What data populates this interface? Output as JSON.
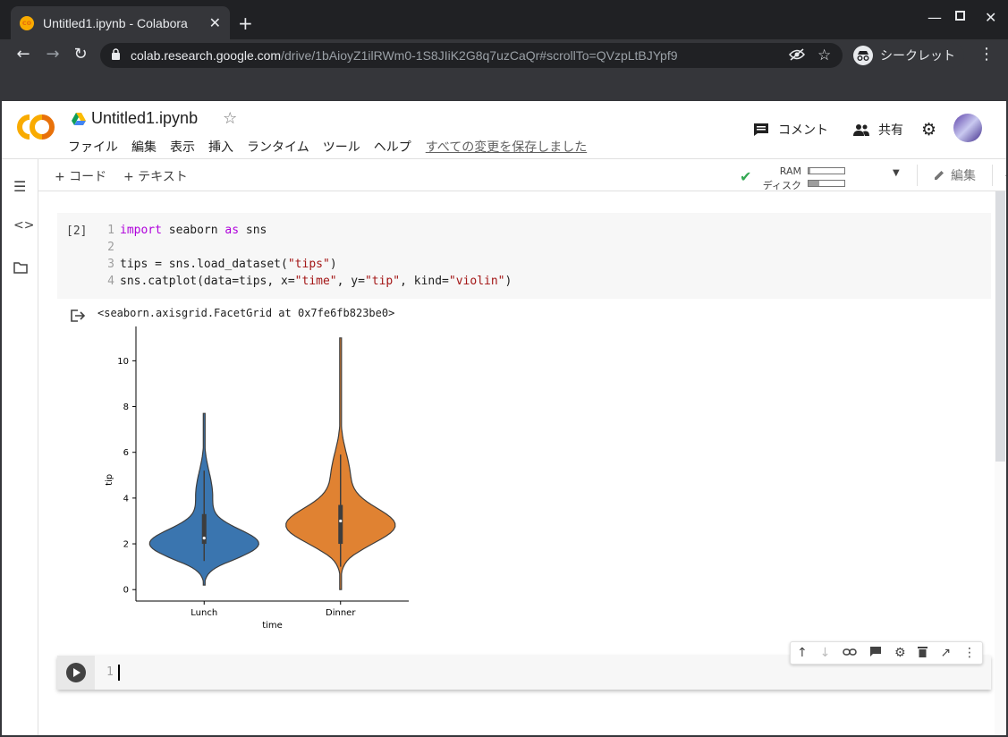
{
  "browser": {
    "tab_title": "Untitled1.ipynb - Colabora",
    "url_host": "colab.research.google.com",
    "url_path": "/drive/1bAioyZ1ilRWm0-1S8JIiK2G8q7uzCaQr#scrollTo=QVzpLtBJYpf9",
    "incognito_label": "シークレット"
  },
  "colab": {
    "doc_title": "Untitled1.ipynb",
    "menu": [
      "ファイル",
      "編集",
      "表示",
      "挿入",
      "ランタイム",
      "ツール",
      "ヘルプ"
    ],
    "saved_status": "すべての変更を保存しました",
    "comment_label": "コメント",
    "share_label": "共有",
    "add_code": "+ コード",
    "add_text": "+ テキスト",
    "ram_label": "RAM",
    "disk_label": "ディスク",
    "ram_usage": 0.05,
    "disk_usage": 0.3,
    "edit_label": "編集"
  },
  "cell1": {
    "exec_count": "[2]",
    "lines": [
      {
        "n": "1"
      },
      {
        "n": "2"
      },
      {
        "n": "3"
      },
      {
        "n": "4"
      }
    ],
    "code": {
      "l1_kw1": "import",
      "l1_mid": " seaborn ",
      "l1_kw2": "as",
      "l1_end": " sns",
      "l3_a": "tips = sns.load_dataset(",
      "l3_s": "\"tips\"",
      "l3_b": ")",
      "l4_a": "sns.catplot(data=tips, x=",
      "l4_s1": "\"time\"",
      "l4_b": ", y=",
      "l4_s2": "\"tip\"",
      "l4_c": ", kind=",
      "l4_s3": "\"violin\"",
      "l4_d": ")"
    },
    "output_text": "<seaborn.axisgrid.FacetGrid at 0x7fe6fb823be0>"
  },
  "chart_data": {
    "type": "violin",
    "categories": [
      "Lunch",
      "Dinner"
    ],
    "xlabel": "time",
    "ylabel": "tip",
    "ylim": [
      -0.5,
      11.5
    ],
    "yticks": [
      0,
      2,
      4,
      6,
      8,
      10
    ],
    "colors": [
      "#3a75af",
      "#e08232"
    ],
    "series": [
      {
        "category": "Lunch",
        "min": 0.2,
        "max": 7.7,
        "q1": 2.0,
        "median": 2.25,
        "q3": 3.3,
        "whisker_low": 1.25,
        "whisker_high": 5.2
      },
      {
        "category": "Dinner",
        "min": 0.0,
        "max": 11.0,
        "q1": 2.0,
        "median": 3.0,
        "q3": 3.7,
        "whisker_low": 1.0,
        "whisker_high": 5.9
      }
    ]
  },
  "cell2": {
    "line": "1"
  }
}
